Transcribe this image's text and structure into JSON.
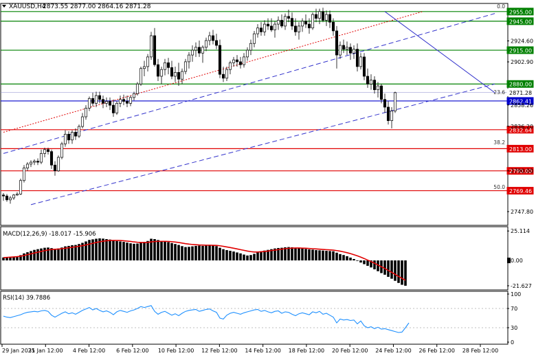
{
  "header": {
    "symbol": "XAUUSD,H4",
    "ohlc": "2873.55 2877.00 2864.16 2871.28"
  },
  "colors": {
    "bull": "#ffffff",
    "bear": "#000000",
    "candle_outline": "#000000",
    "support": "#e00000",
    "resistance": "#008000",
    "current": "#0000cc",
    "trend": "#3333cc",
    "macd_signal": "#e00000",
    "rsi": "#1e90ff"
  },
  "chart_data": [
    {
      "type": "candlestick",
      "name": "price",
      "ylim": [
        2735,
        2962
      ],
      "y_ticks": [
        "2924.60",
        "2902.90",
        "2858.26",
        "2836.20",
        "2790.00",
        "2747.80"
      ],
      "x_labels": [
        "29 Jan 2025",
        "31 Jan 12:00",
        "4 Feb 12:00",
        "6 Feb 12:00",
        "10 Feb 12:00",
        "12 Feb 12:00",
        "14 Feb 12:00",
        "18 Feb 12:00",
        "20 Feb 12:00",
        "24 Feb 12:00",
        "26 Feb 12:00",
        "28 Feb 12:00"
      ],
      "horizontal_levels": [
        {
          "value": 2955.0,
          "label": "2955.00",
          "kind": "resistance"
        },
        {
          "value": 2945.0,
          "label": "2945.00",
          "kind": "resistance"
        },
        {
          "value": 2915.0,
          "label": "2915.00",
          "kind": "resistance"
        },
        {
          "value": 2880.0,
          "label": "2880.00",
          "kind": "resistance"
        },
        {
          "value": 2871.28,
          "label": "2871.28",
          "kind": "price"
        },
        {
          "value": 2862.41,
          "label": "2862.41",
          "kind": "current"
        },
        {
          "value": 2832.64,
          "label": "2832.64",
          "kind": "support"
        },
        {
          "value": 2813.0,
          "label": "2813.00",
          "kind": "support"
        },
        {
          "value": 2790.0,
          "label": "2790.00",
          "kind": "support"
        },
        {
          "value": 2769.46,
          "label": "2769.46",
          "kind": "support"
        }
      ],
      "fib_labels": [
        {
          "value": 2957,
          "label": "0.0"
        },
        {
          "value": 2868,
          "label": "23.6"
        },
        {
          "value": 2816,
          "label": "38.2"
        },
        {
          "value": 2770,
          "label": "50.0"
        }
      ],
      "trend_lines": [
        {
          "style": "dashed",
          "color": "#3333cc",
          "p1": [
            0,
            2808
          ],
          "p2": [
            143,
            2953
          ]
        },
        {
          "style": "dashed",
          "color": "#3333cc",
          "p1": [
            8,
            2755
          ],
          "p2": [
            143,
            2880
          ]
        },
        {
          "style": "dotted",
          "color": "#e00000",
          "p1": [
            0,
            2830
          ],
          "p2": [
            122,
            2955
          ]
        },
        {
          "style": "solid",
          "color": "#3333cc",
          "p1": [
            111,
            2955
          ],
          "p2": [
            143,
            2871
          ]
        }
      ],
      "candles": [
        [
          2765,
          2767,
          2759,
          2764
        ],
        [
          2764,
          2766,
          2758,
          2760
        ],
        [
          2760,
          2764,
          2756,
          2762
        ],
        [
          2762,
          2766,
          2760,
          2765
        ],
        [
          2765,
          2768,
          2764,
          2766
        ],
        [
          2766,
          2782,
          2765,
          2780
        ],
        [
          2780,
          2796,
          2778,
          2793
        ],
        [
          2793,
          2799,
          2790,
          2797
        ],
        [
          2797,
          2801,
          2794,
          2799
        ],
        [
          2799,
          2802,
          2796,
          2800
        ],
        [
          2800,
          2803,
          2796,
          2799
        ],
        [
          2799,
          2812,
          2797,
          2808
        ],
        [
          2808,
          2814,
          2804,
          2812
        ],
        [
          2812,
          2814,
          2807,
          2810
        ],
        [
          2810,
          2812,
          2792,
          2796
        ],
        [
          2796,
          2800,
          2785,
          2790
        ],
        [
          2790,
          2806,
          2789,
          2804
        ],
        [
          2804,
          2820,
          2802,
          2818
        ],
        [
          2818,
          2832,
          2815,
          2828
        ],
        [
          2828,
          2831,
          2818,
          2822
        ],
        [
          2822,
          2832,
          2818,
          2830
        ],
        [
          2830,
          2834,
          2822,
          2826
        ],
        [
          2826,
          2838,
          2824,
          2836
        ],
        [
          2836,
          2850,
          2834,
          2846
        ],
        [
          2846,
          2858,
          2843,
          2855
        ],
        [
          2855,
          2867,
          2852,
          2865
        ],
        [
          2865,
          2871,
          2857,
          2860
        ],
        [
          2860,
          2872,
          2856,
          2868
        ],
        [
          2868,
          2872,
          2860,
          2864
        ],
        [
          2864,
          2868,
          2855,
          2860
        ],
        [
          2860,
          2866,
          2856,
          2862
        ],
        [
          2862,
          2866,
          2853,
          2858
        ],
        [
          2858,
          2864,
          2846,
          2850
        ],
        [
          2850,
          2862,
          2848,
          2860
        ],
        [
          2860,
          2868,
          2856,
          2864
        ],
        [
          2864,
          2869,
          2858,
          2862
        ],
        [
          2862,
          2868,
          2856,
          2860
        ],
        [
          2860,
          2868,
          2857,
          2866
        ],
        [
          2866,
          2872,
          2863,
          2870
        ],
        [
          2870,
          2882,
          2868,
          2880
        ],
        [
          2880,
          2898,
          2878,
          2896
        ],
        [
          2896,
          2904,
          2888,
          2898
        ],
        [
          2898,
          2911,
          2893,
          2908
        ],
        [
          2908,
          2934,
          2905,
          2930
        ],
        [
          2930,
          2938,
          2898,
          2900
        ],
        [
          2900,
          2906,
          2883,
          2888
        ],
        [
          2888,
          2898,
          2880,
          2895
        ],
        [
          2895,
          2906,
          2889,
          2902
        ],
        [
          2902,
          2907,
          2890,
          2897
        ],
        [
          2897,
          2904,
          2885,
          2888
        ],
        [
          2888,
          2898,
          2882,
          2892
        ],
        [
          2892,
          2902,
          2878,
          2885
        ],
        [
          2885,
          2896,
          2880,
          2893
        ],
        [
          2893,
          2906,
          2890,
          2903
        ],
        [
          2903,
          2913,
          2896,
          2910
        ],
        [
          2910,
          2920,
          2903,
          2915
        ],
        [
          2915,
          2923,
          2908,
          2918
        ],
        [
          2918,
          2925,
          2908,
          2912
        ],
        [
          2912,
          2920,
          2902,
          2918
        ],
        [
          2918,
          2928,
          2914,
          2925
        ],
        [
          2925,
          2934,
          2920,
          2930
        ],
        [
          2930,
          2936,
          2921,
          2925
        ],
        [
          2925,
          2932,
          2916,
          2920
        ],
        [
          2920,
          2926,
          2886,
          2890
        ],
        [
          2890,
          2898,
          2882,
          2886
        ],
        [
          2886,
          2898,
          2883,
          2895
        ],
        [
          2895,
          2904,
          2890,
          2902
        ],
        [
          2902,
          2908,
          2898,
          2905
        ],
        [
          2905,
          2910,
          2898,
          2903
        ],
        [
          2903,
          2908,
          2896,
          2900
        ],
        [
          2900,
          2912,
          2897,
          2908
        ],
        [
          2908,
          2918,
          2904,
          2915
        ],
        [
          2915,
          2926,
          2910,
          2922
        ],
        [
          2922,
          2935,
          2918,
          2932
        ],
        [
          2932,
          2942,
          2928,
          2938
        ],
        [
          2938,
          2944,
          2930,
          2934
        ],
        [
          2934,
          2946,
          2930,
          2942
        ],
        [
          2942,
          2948,
          2936,
          2940
        ],
        [
          2940,
          2948,
          2934,
          2936
        ],
        [
          2936,
          2945,
          2928,
          2942
        ],
        [
          2942,
          2950,
          2936,
          2946
        ],
        [
          2946,
          2952,
          2938,
          2940
        ],
        [
          2940,
          2953,
          2936,
          2950
        ],
        [
          2950,
          2957,
          2944,
          2948
        ],
        [
          2948,
          2954,
          2936,
          2940
        ],
        [
          2940,
          2948,
          2930,
          2934
        ],
        [
          2934,
          2944,
          2926,
          2940
        ],
        [
          2940,
          2948,
          2934,
          2945
        ],
        [
          2945,
          2952,
          2938,
          2942
        ],
        [
          2942,
          2948,
          2932,
          2938
        ],
        [
          2938,
          2954,
          2936,
          2952
        ],
        [
          2952,
          2958,
          2944,
          2948
        ],
        [
          2948,
          2958,
          2942,
          2955
        ],
        [
          2955,
          2959,
          2944,
          2946
        ],
        [
          2946,
          2956,
          2940,
          2952
        ],
        [
          2952,
          2956,
          2938,
          2944
        ],
        [
          2944,
          2948,
          2930,
          2935
        ],
        [
          2935,
          2940,
          2896,
          2910
        ],
        [
          2910,
          2924,
          2906,
          2920
        ],
        [
          2920,
          2926,
          2912,
          2916
        ],
        [
          2916,
          2924,
          2910,
          2918
        ],
        [
          2918,
          2922,
          2905,
          2912
        ],
        [
          2912,
          2920,
          2906,
          2916
        ],
        [
          2916,
          2922,
          2893,
          2898
        ],
        [
          2898,
          2912,
          2895,
          2908
        ],
        [
          2908,
          2912,
          2884,
          2888
        ],
        [
          2888,
          2896,
          2876,
          2880
        ],
        [
          2880,
          2890,
          2874,
          2884
        ],
        [
          2884,
          2888,
          2870,
          2874
        ],
        [
          2874,
          2882,
          2866,
          2878
        ],
        [
          2878,
          2880,
          2860,
          2864
        ],
        [
          2864,
          2870,
          2850,
          2856
        ],
        [
          2856,
          2862,
          2838,
          2842
        ],
        [
          2842,
          2856,
          2834,
          2852
        ],
        [
          2852,
          2872,
          2850,
          2871
        ]
      ],
      "candle_start_index": 0
    },
    {
      "type": "histogram",
      "name": "MACD",
      "label": "MACD(12,26,9) -18.017 -15.906",
      "ylim": [
        -24,
        27
      ],
      "y_ticks": [
        "25.114",
        "0.00",
        "-21.627"
      ],
      "histogram": [
        2.5,
        2.8,
        3.0,
        3.2,
        3.5,
        4.5,
        6.0,
        7.0,
        8.0,
        9.0,
        9.6,
        10.2,
        10.8,
        11.0,
        10.5,
        9.8,
        10.2,
        11.0,
        12.0,
        12.4,
        13.0,
        13.2,
        14.0,
        15.0,
        16.2,
        17.5,
        18.0,
        18.5,
        18.8,
        18.6,
        18.2,
        17.8,
        17.0,
        16.5,
        16.2,
        15.8,
        15.2,
        14.6,
        14.2,
        14.4,
        15.2,
        15.8,
        16.6,
        18.5,
        18.2,
        17.4,
        16.6,
        16.2,
        15.6,
        14.8,
        14.0,
        13.2,
        12.2,
        11.4,
        11.6,
        12.0,
        12.4,
        12.6,
        12.4,
        12.6,
        13.0,
        12.8,
        12.2,
        10.8,
        9.6,
        8.8,
        8.2,
        7.6,
        6.8,
        6.0,
        5.0,
        4.2,
        4.6,
        5.6,
        6.8,
        7.8,
        8.4,
        9.0,
        9.6,
        10.2,
        10.6,
        10.8,
        11.2,
        11.4,
        11.2,
        10.8,
        10.6,
        10.2,
        9.8,
        9.4,
        9.2,
        8.8,
        8.6,
        8.4,
        8.2,
        8.0,
        7.8,
        6.6,
        5.4,
        4.6,
        3.6,
        2.4,
        1.2,
        -0.4,
        -1.8,
        -3.2,
        -4.6,
        -6.0,
        -7.6,
        -9.2,
        -10.8,
        -12.2,
        -14.0,
        -15.6,
        -17.4,
        -19.2,
        -20.8,
        -21.6
      ],
      "signal": [
        2.4,
        2.6,
        2.8,
        3.0,
        3.2,
        3.6,
        4.2,
        4.9,
        5.6,
        6.3,
        7.0,
        7.7,
        8.3,
        8.9,
        9.3,
        9.5,
        9.7,
        10.0,
        10.4,
        10.8,
        11.2,
        11.6,
        12.1,
        12.6,
        13.2,
        13.9,
        14.6,
        15.3,
        15.9,
        16.4,
        16.8,
        17.0,
        17.1,
        17.1,
        17.0,
        16.8,
        16.5,
        16.2,
        15.8,
        15.5,
        15.3,
        15.3,
        15.4,
        15.8,
        16.1,
        16.3,
        16.3,
        16.3,
        16.2,
        16.0,
        15.7,
        15.3,
        14.8,
        14.3,
        13.9,
        13.6,
        13.4,
        13.2,
        13.1,
        13.0,
        13.0,
        12.9,
        12.8,
        12.5,
        12.0,
        11.5,
        11.0,
        10.4,
        9.8,
        9.2,
        8.6,
        8.0,
        7.5,
        7.2,
        7.2,
        7.4,
        7.7,
        8.0,
        8.4,
        8.8,
        9.2,
        9.6,
        10.0,
        10.3,
        10.5,
        10.6,
        10.6,
        10.5,
        10.4,
        10.2,
        10.0,
        9.8,
        9.6,
        9.4,
        9.2,
        9.0,
        8.8,
        8.4,
        7.9,
        7.3,
        6.6,
        5.8,
        4.9,
        3.9,
        2.8,
        1.6,
        0.3,
        -1.0,
        -2.4,
        -3.9,
        -5.4,
        -6.9,
        -8.5,
        -10.2,
        -11.9,
        -13.6,
        -15.3,
        -16.9
      ]
    },
    {
      "type": "line",
      "name": "RSI",
      "label": "RSI(14) 39.7886",
      "ylim": [
        0,
        100
      ],
      "y_ticks": [
        "100",
        "70",
        "30",
        "0"
      ],
      "levels": [
        70,
        30
      ],
      "values": [
        54,
        52,
        51,
        53,
        55,
        57,
        60,
        62,
        63,
        64,
        63,
        65,
        66,
        64,
        56,
        52,
        56,
        60,
        63,
        59,
        61,
        58,
        62,
        66,
        69,
        72,
        67,
        70,
        66,
        63,
        65,
        62,
        57,
        63,
        66,
        64,
        62,
        65,
        67,
        70,
        74,
        72,
        74,
        76,
        64,
        58,
        62,
        64,
        60,
        56,
        59,
        55,
        60,
        64,
        66,
        67,
        68,
        64,
        66,
        68,
        69,
        65,
        62,
        50,
        48,
        56,
        60,
        62,
        60,
        58,
        61,
        63,
        65,
        67,
        68,
        64,
        66,
        63,
        61,
        64,
        65,
        60,
        63,
        62,
        58,
        55,
        59,
        61,
        59,
        57,
        63,
        61,
        64,
        58,
        60,
        56,
        52,
        40,
        48,
        46,
        47,
        45,
        46,
        38,
        44,
        34,
        30,
        32,
        28,
        31,
        27,
        28,
        26,
        24,
        22,
        20,
        21,
        30,
        40
      ]
    }
  ]
}
